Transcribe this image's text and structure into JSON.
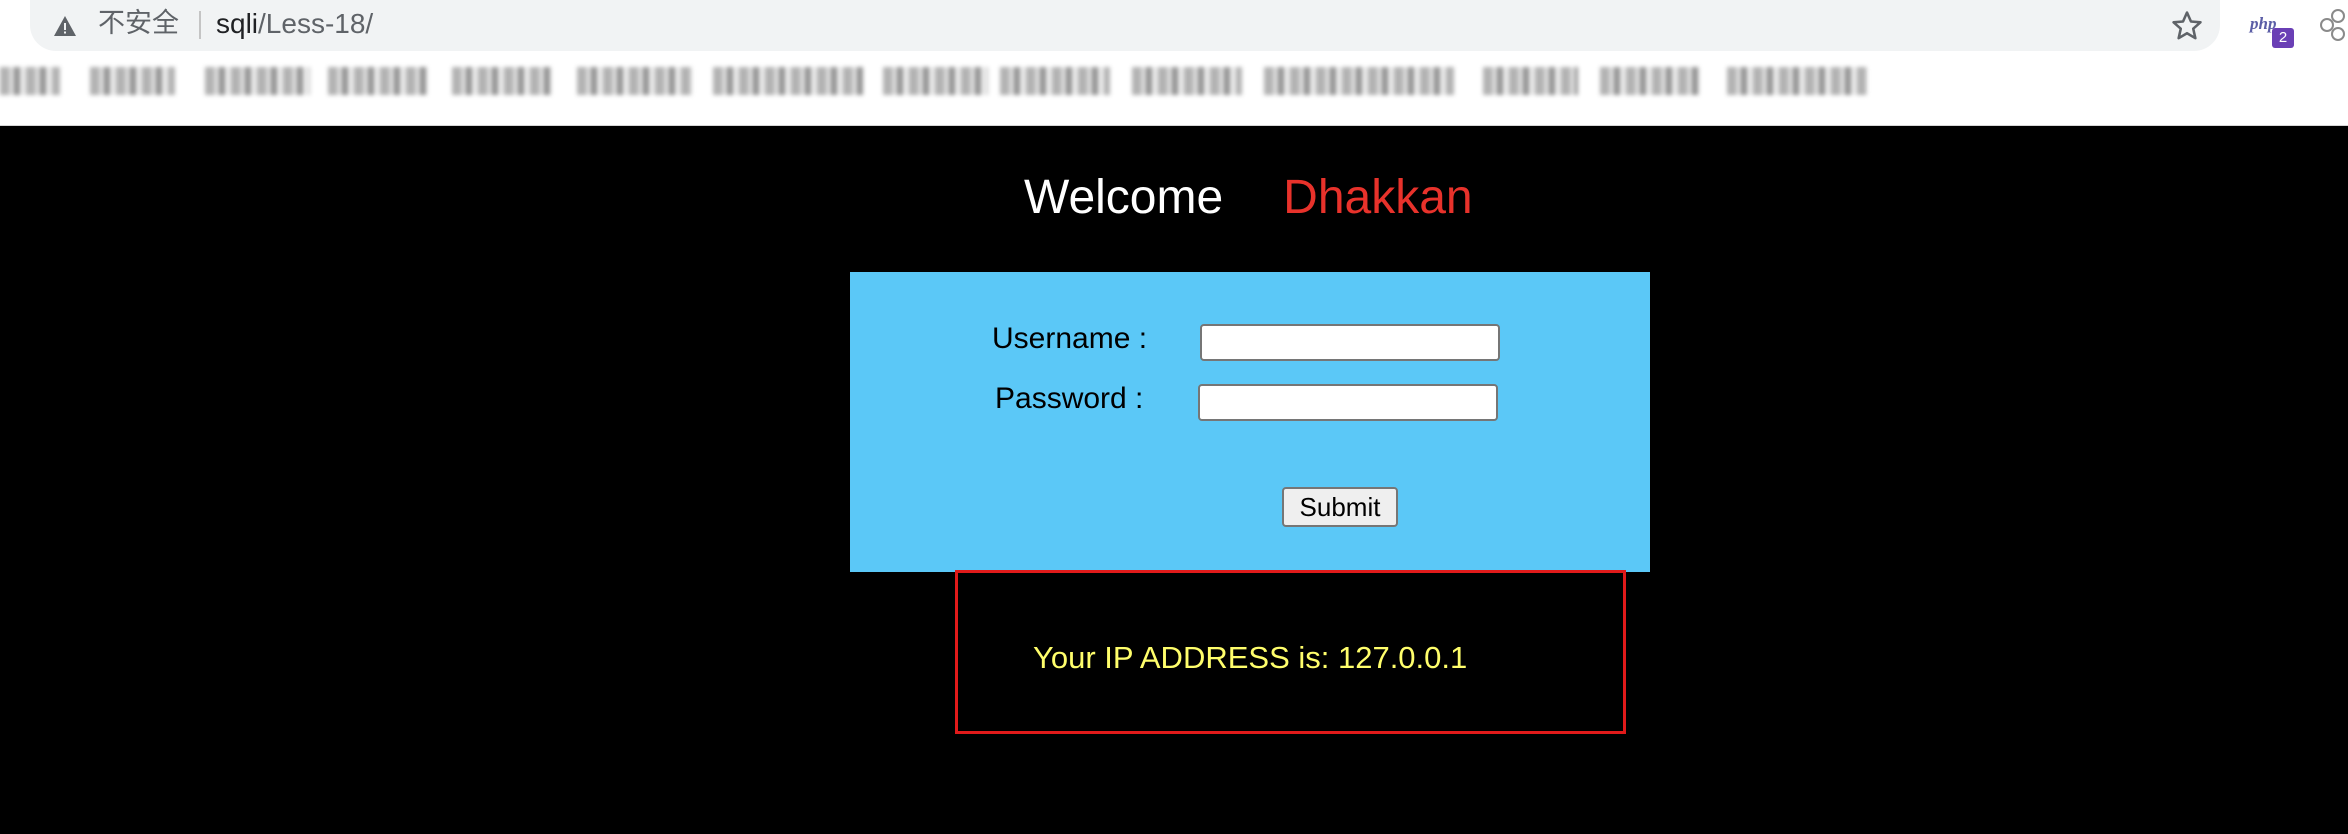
{
  "browser": {
    "security_label": "不安全",
    "url_host": "sqli",
    "url_path": "/Less-18/",
    "extension_php_label": "php",
    "extension_php_badge": "2"
  },
  "page": {
    "welcome_text": "Welcome",
    "welcome_name": "Dhakkan",
    "colors": {
      "background": "#000000",
      "form_background": "#5bc8f7",
      "name": "#e8322b",
      "ip_text": "#fffe6b",
      "ip_box_border": "#e01a1a"
    },
    "form": {
      "username_label": "Username :",
      "username_value": "",
      "password_label": "Password :",
      "password_value": "",
      "submit_label": "Submit"
    },
    "ip_message": "Your IP ADDRESS is: 127.0.0.1"
  }
}
